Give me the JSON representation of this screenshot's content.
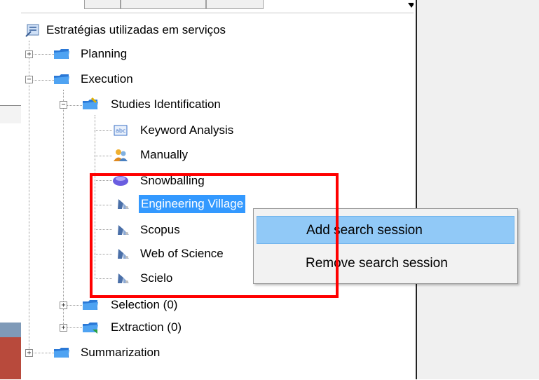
{
  "tree": {
    "root": {
      "label": "Estratégias utilizadas em serviços"
    },
    "nodes": [
      {
        "label": "Planning",
        "expander": "+"
      },
      {
        "label": "Execution",
        "expander": "−"
      },
      {
        "label": "Studies Identification",
        "expander": "−"
      },
      {
        "label": "Keyword Analysis"
      },
      {
        "label": "Manually"
      },
      {
        "label": "Snowballing"
      },
      {
        "label": "Engineering Village",
        "selected": true
      },
      {
        "label": "Scopus"
      },
      {
        "label": "Web of Science"
      },
      {
        "label": "Scielo"
      },
      {
        "label": "Selection (0)",
        "expander": "+"
      },
      {
        "label": "Extraction (0)",
        "expander": "+"
      },
      {
        "label": "Summarization",
        "expander": "+"
      }
    ]
  },
  "context_menu": {
    "items": [
      {
        "label": "Add search session",
        "highlighted": true
      },
      {
        "label": "Remove search session"
      }
    ]
  },
  "colors": {
    "selection": "#3399ff",
    "menu_highlight": "#91c9f7",
    "annotation_frame": "#ff0000"
  }
}
